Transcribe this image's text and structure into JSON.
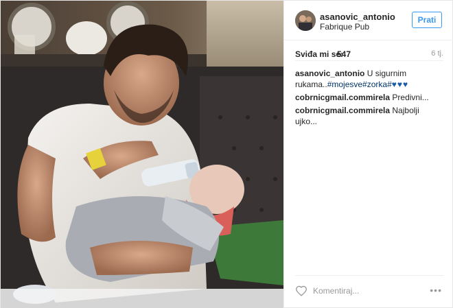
{
  "post": {
    "author": {
      "username": "asanovic_antonio",
      "location": "Fabrique Pub"
    },
    "follow_label": "Prati",
    "likes": {
      "label": "Sviđa mi se:",
      "count": "547"
    },
    "time_ago": "6 tj.",
    "caption": {
      "username": "asanovic_antonio",
      "text": "U sigurnim rukama..",
      "tags": "#mojesve#zorka#",
      "hearts": "♥♥♥"
    },
    "comments": [
      {
        "username": "cobrnicgmail.commirela",
        "text": "Predivni..."
      },
      {
        "username": "cobrnicgmail.commirela",
        "text": "Najbolji ujko..."
      }
    ],
    "comment_input": {
      "placeholder": "Komentiraj..."
    },
    "more_label": "•••"
  },
  "icons": {
    "like": "heart-outline-icon",
    "more": "more-options-icon"
  },
  "colors": {
    "link_blue": "#3897f0",
    "tag_blue": "#003569",
    "border": "#efefef",
    "muted": "#999999"
  }
}
